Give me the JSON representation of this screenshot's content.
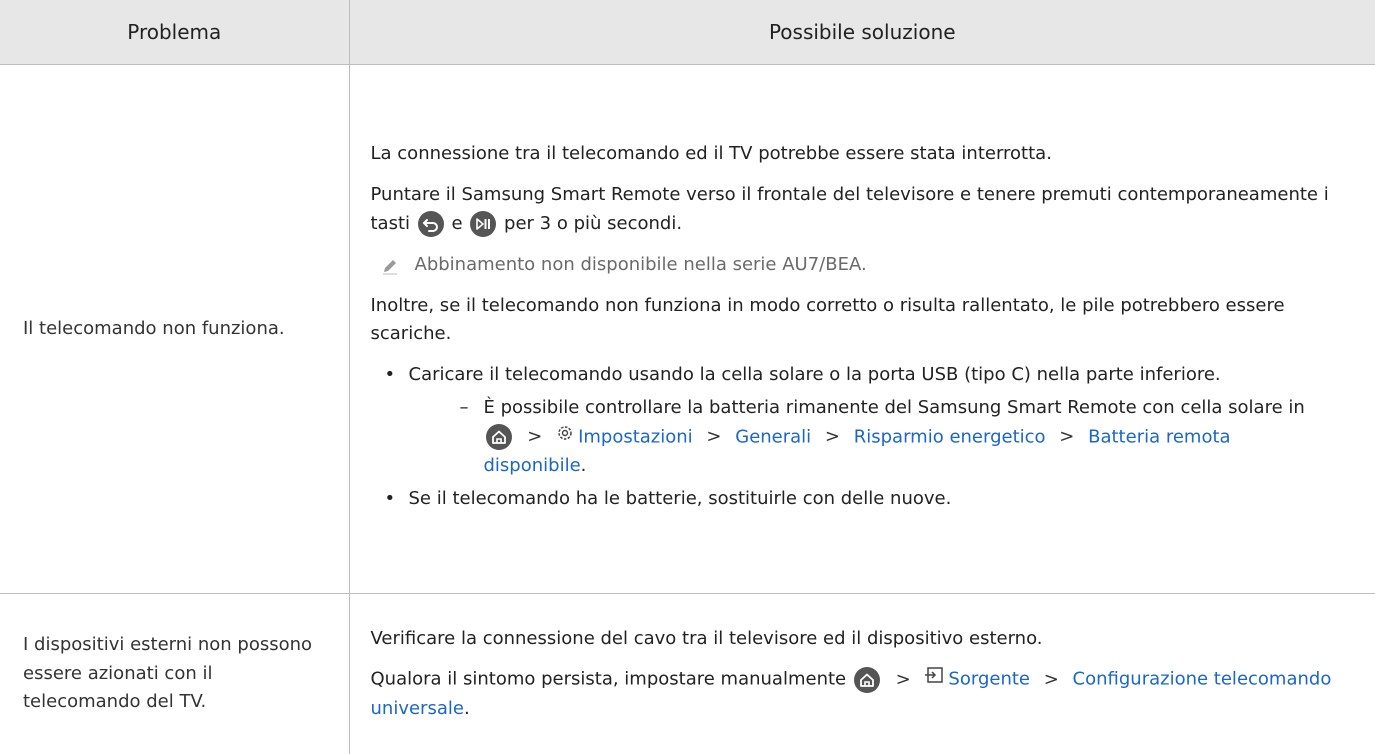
{
  "header": {
    "col_problem": "Problema",
    "col_solution": "Possibile soluzione"
  },
  "rows": [
    {
      "problem": "Il telecomando non funziona.",
      "p1": "La connessione tra il telecomando ed il TV potrebbe essere stata interrotta.",
      "p2_a": "Puntare il Samsung Smart Remote verso il frontale del televisore e tenere premuti contemporaneamente i tasti",
      "p2_e": "e",
      "p2_b": "per 3 o più secondi.",
      "note": "Abbinamento non disponibile nella serie AU7/BEA.",
      "p3": "Inoltre, se il telecomando non funziona in modo corretto o risulta rallentato, le pile potrebbero essere scariche.",
      "bullet1": "Caricare il telecomando usando la cella solare o la porta USB (tipo C) nella parte inferiore.",
      "sub_dash": "–",
      "sub_text": "È possibile controllare la batteria rimanente del Samsung Smart Remote con cella solare in",
      "path": [
        "Impostazioni",
        "Generali",
        "Risparmio energetico",
        "Batteria remota disponibile"
      ],
      "sub_end": ".",
      "bullet2": "Se il telecomando ha le batterie, sostituirle con delle nuove."
    },
    {
      "problem": "I dispositivi esterni non possono essere azionati con il telecomando del TV.",
      "p1": "Verificare la connessione del cavo tra il televisore ed il dispositivo esterno.",
      "p2_a": "Qualora il sintomo persista, impostare manualmente",
      "path": [
        "Sorgente",
        "Configurazione telecomando universale"
      ],
      "p2_end": "."
    }
  ],
  "chevron": ">",
  "icons": [
    "return-button-icon",
    "play-pause-button-icon",
    "home-icon",
    "settings-gear-icon",
    "source-input-icon",
    "pencil-note-icon"
  ],
  "colors": {
    "link": "#1a66c9",
    "header_bg": "#e7e7e7",
    "border": "#bdbdbd",
    "icon": "#555555"
  }
}
